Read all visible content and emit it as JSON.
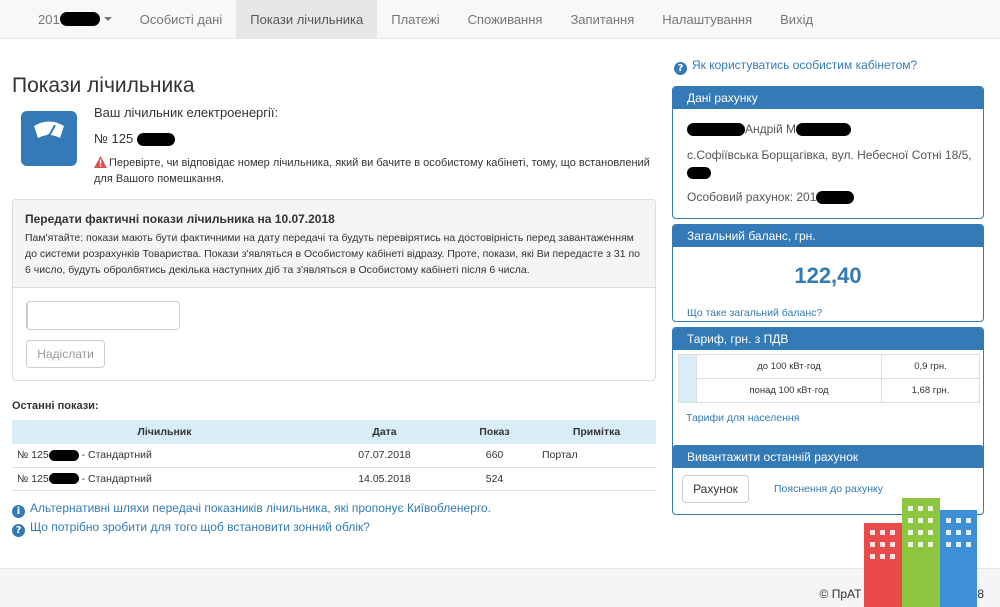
{
  "nav": {
    "account_prefix": "201",
    "items": [
      "Особисті дані",
      "Покази лічильника",
      "Платежі",
      "Споживання",
      "Запитання",
      "Налаштування",
      "Вихід"
    ],
    "active": "Покази лічильника"
  },
  "page": {
    "title": "Покази лічильника",
    "meter_label": "Ваш лічильник електроенергії:",
    "meter_number_prefix": "№ 125",
    "warning": "Перевірте, чи відповідає номер лічильника, який ви бачите в особистому кабінеті, тому, що встановлений для Вашого помешкання."
  },
  "submit": {
    "title": "Передати фактичні покази лічильника на 10.07.2018",
    "text": "Пам'ятайте: покази мають бути фактичними на дату передачі та будуть перевірятись на достовірність перед завантаженням до системи розрахунків Товариства. Покази з'являться в Особистому кабінеті відразу. Проте, покази, які Ви передасте з 31 по 6 число, будуть обролбятись декілька наступних діб та з'являться в Особистому кабінеті після 6 числа.",
    "input_value": "",
    "button": "Надіслати"
  },
  "last_readings": {
    "title": "Останні покази:",
    "columns": [
      "Лічильник",
      "Дата",
      "Показ",
      "Примітка"
    ],
    "rows": [
      {
        "meter_prefix": "№ 125",
        "meter_suffix": " - Стандартний",
        "date": "07.07.2018",
        "reading": "660",
        "note": "Портал"
      },
      {
        "meter_prefix": "№ 125",
        "meter_suffix": " - Стандартний",
        "date": "14.05.2018",
        "reading": "524",
        "note": ""
      }
    ]
  },
  "info_links": [
    "Альтернативні шляхи передачі показників лічильника, які пропонує Київобленерго.",
    "Що потрібно зробити для того щоб встановити зонний облік?"
  ],
  "sidebar": {
    "help_link": "Як користуватись особистим кабінетом?",
    "account": {
      "title": "Дані рахунку",
      "name_visible": "Андрій М",
      "address": "с.Софіївська Борщагівка, вул. Небесної Сотні 18/5,",
      "account_label": "Особовий рахунок: 201"
    },
    "balance": {
      "title": "Загальний баланс, грн.",
      "value": "122,40",
      "link": "Що таке загальний баланс?"
    },
    "tariff": {
      "title": "Тариф, грн. з ПДВ",
      "rows": [
        {
          "desc": "до 100 кВт·год",
          "price": "0,9 грн."
        },
        {
          "desc": "понад 100 кВт·год",
          "price": "1,68 грн."
        }
      ],
      "link": "Тарифи для населення"
    },
    "invoice": {
      "title": "Вивантажити останній рахунок",
      "button": "Рахунок",
      "link": "Пояснення до рахунку"
    }
  },
  "footer": {
    "copyright": "© ПрАТ \"Київобленерго\" 2018"
  },
  "colors": {
    "brand": "#337ab7",
    "table_header": "#d9edf7",
    "warning": "#d9534f"
  }
}
